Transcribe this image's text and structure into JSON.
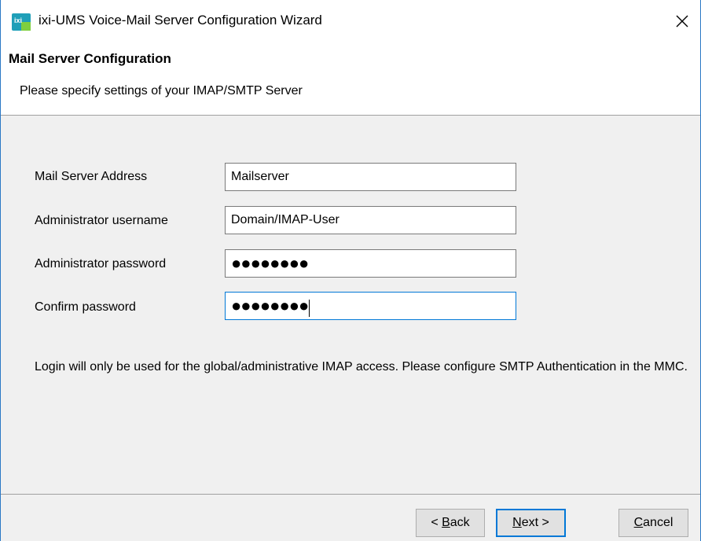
{
  "window": {
    "title": "ixi-UMS Voice-Mail Server Configuration Wizard",
    "close_icon": "close-icon",
    "app_icon": "ixi-ums-app-icon"
  },
  "header": {
    "title": "Mail Server Configuration",
    "subtitle": "Please specify settings of your IMAP/SMTP Server"
  },
  "form": {
    "mail_server_address": {
      "label": "Mail Server Address",
      "value": "Mailserver"
    },
    "admin_username": {
      "label": "Administrator username",
      "value": "Domain/IMAP-User"
    },
    "admin_password": {
      "label": "Administrator password",
      "masked_value": "●●●●●●●●"
    },
    "confirm_password": {
      "label": "Confirm password",
      "masked_value": "●●●●●●●●"
    }
  },
  "note": "Login will only be used for the global/administrative IMAP access. Please configure SMTP Authentication in the MMC.",
  "buttons": {
    "back": {
      "mnemonic": "B",
      "rest": "ack",
      "prefix": "< "
    },
    "next": {
      "mnemonic": "N",
      "rest": "ext",
      "suffix": " >"
    },
    "cancel": {
      "mnemonic": "C",
      "rest": "ancel"
    }
  },
  "colors": {
    "accent": "#0078d7",
    "border": "#2b78c5",
    "background": "#f0f0f0"
  }
}
